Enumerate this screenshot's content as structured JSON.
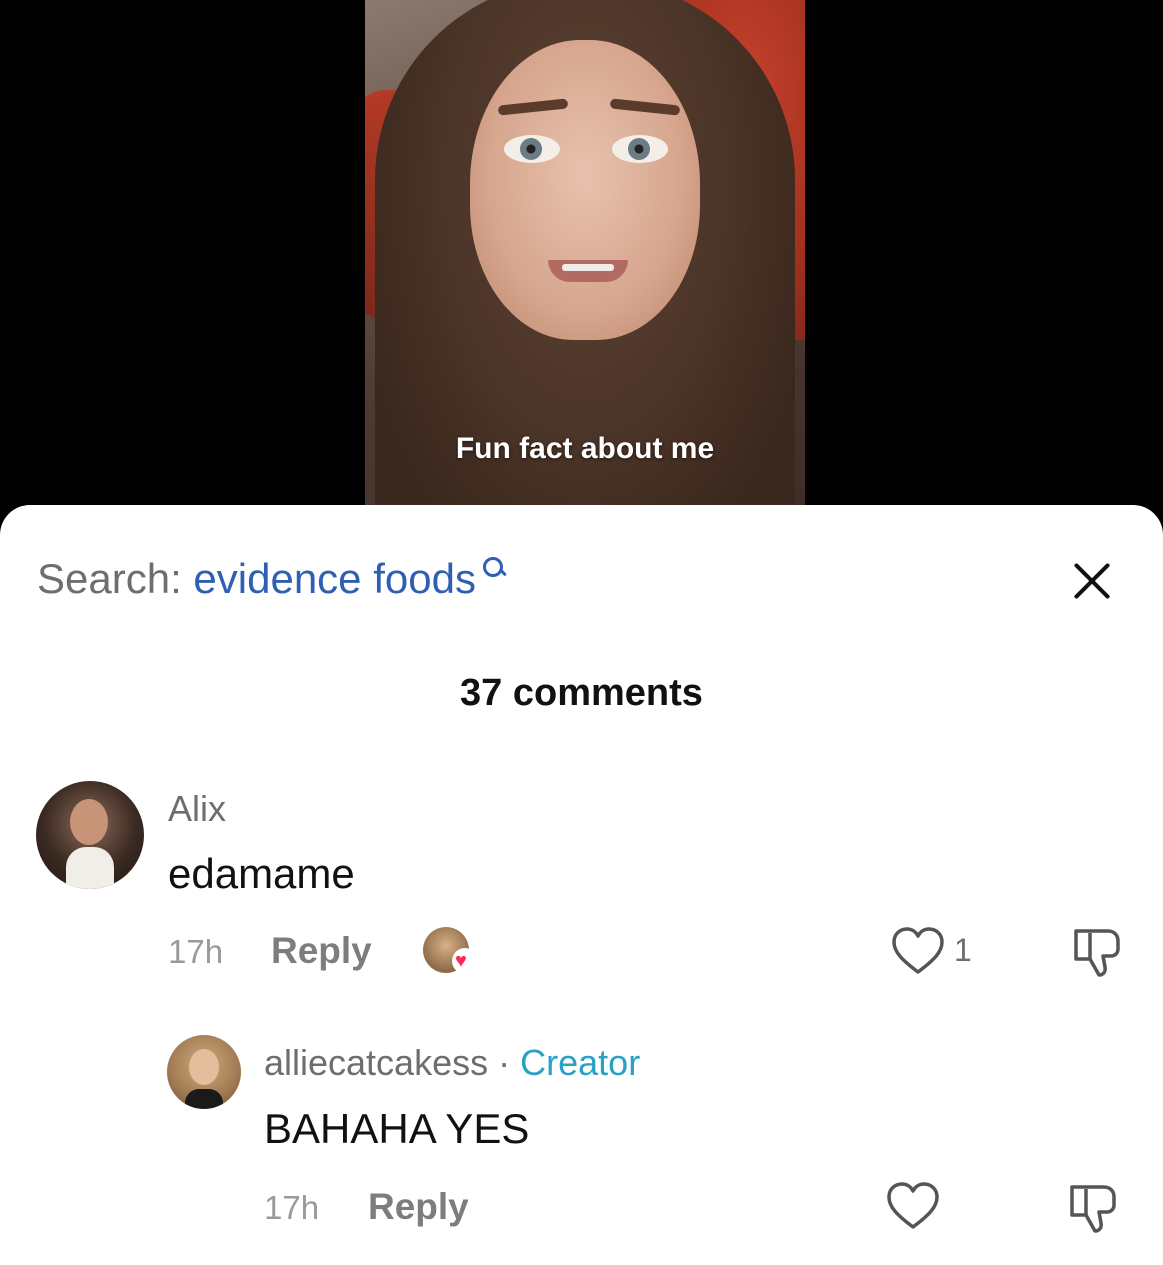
{
  "video": {
    "caption": "Fun fact about me"
  },
  "comments_sheet": {
    "search_label": "Search:",
    "search_term": "evidence foods",
    "count_label": "37 comments",
    "comments": [
      {
        "username": "Alix",
        "text": "edamame",
        "time": "17h",
        "reply_label": "Reply",
        "like_count": "1"
      },
      {
        "username": "alliecatcakess",
        "separator": "·",
        "badge": "Creator",
        "text": "BAHAHA YES",
        "time": "17h",
        "reply_label": "Reply"
      }
    ]
  },
  "colors": {
    "search_term": "#2f5fb5",
    "creator_badge": "#27a1c4",
    "heart": "#fe2c55"
  },
  "icons": [
    "search-icon",
    "close-icon",
    "heart-icon",
    "dislike-icon",
    "liked-by-creator-heart-icon"
  ]
}
